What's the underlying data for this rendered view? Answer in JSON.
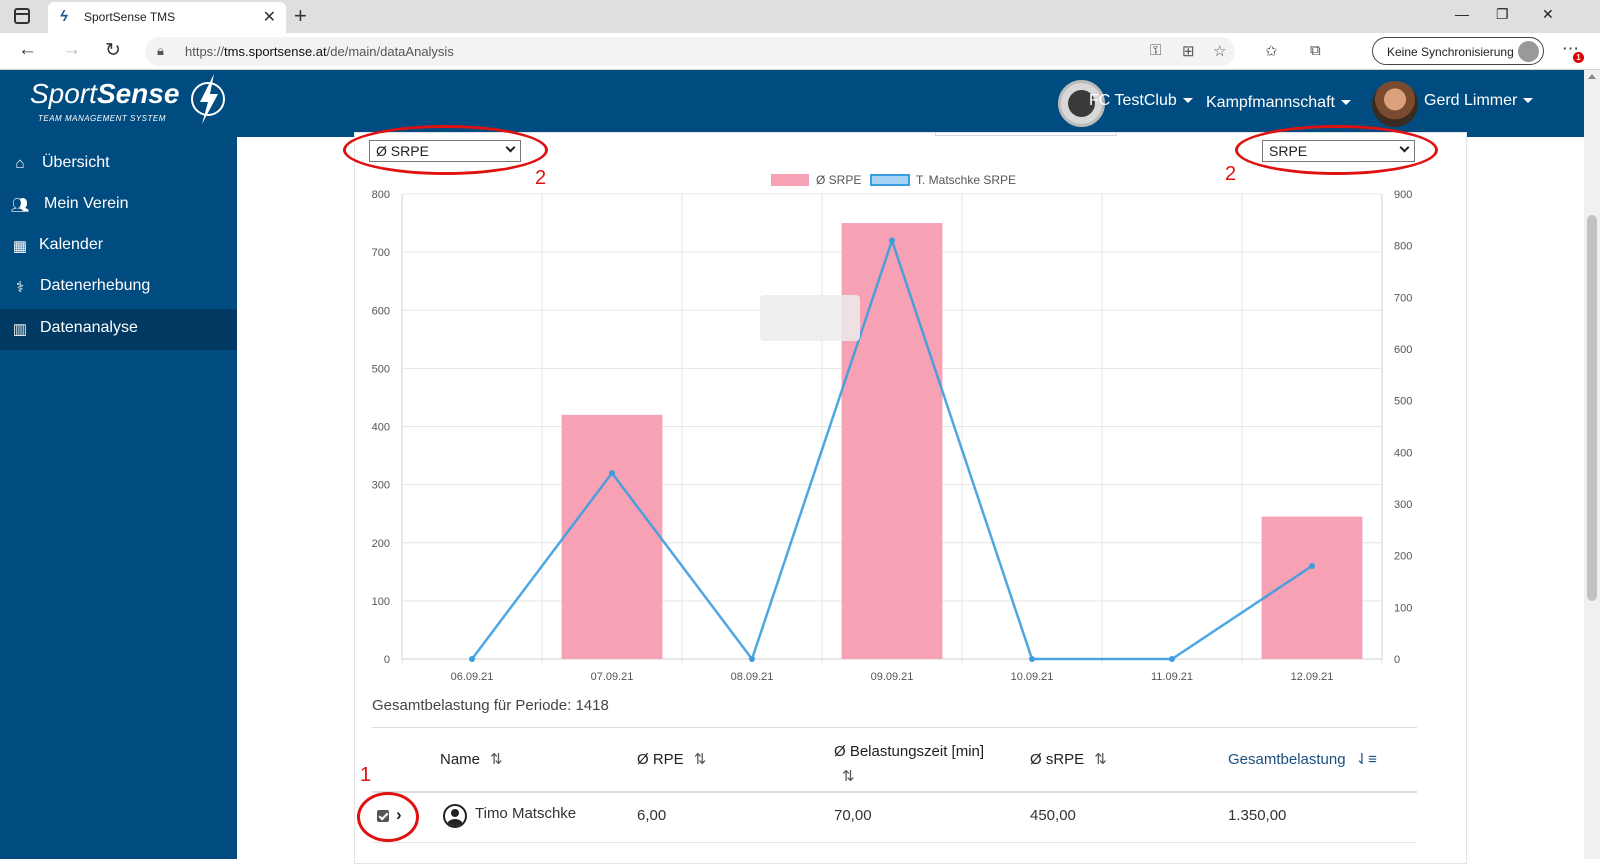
{
  "browser": {
    "tab_title": "SportSense TMS",
    "url_prefix": "https://",
    "url_host": "tms.sportsense.at",
    "url_path": "/de/main/dataAnalysis",
    "sync_label": "Keine Synchronisierung",
    "notification_count": "1"
  },
  "header": {
    "logo_sport": "Sport",
    "logo_sense": "Sense",
    "logo_sub": "TEAM MANAGEMENT SYSTEM",
    "club": "FC TestClub",
    "team": "Kampfmannschaft",
    "user": "Gerd Limmer"
  },
  "sidebar": {
    "items": [
      {
        "label": "Übersicht",
        "icon": "home-icon"
      },
      {
        "label": "Mein Verein",
        "icon": "users-icon"
      },
      {
        "label": "Kalender",
        "icon": "calendar-icon"
      },
      {
        "label": "Datenerhebung",
        "icon": "stethoscope-icon"
      },
      {
        "label": "Datenanalyse",
        "icon": "bar-chart-icon",
        "active": true
      }
    ]
  },
  "controls": {
    "left_select": "Ø SRPE",
    "right_select": "SRPE",
    "annotation_left": "2",
    "annotation_right": "2",
    "annotation_row": "1"
  },
  "chart_data": {
    "type": "bar",
    "categories": [
      "06.09.21",
      "07.09.21",
      "08.09.21",
      "09.09.21",
      "10.09.21",
      "11.09.21",
      "12.09.21"
    ],
    "series": [
      {
        "name": "Ø SRPE",
        "type": "bar",
        "axis": "left",
        "values": [
          0,
          420,
          0,
          750,
          0,
          0,
          245
        ],
        "color": "#f7a1b5"
      },
      {
        "name": "T. Matschke SRPE",
        "type": "line",
        "axis": "right",
        "values": [
          0,
          360,
          0,
          810,
          0,
          0,
          180
        ],
        "color": "#3a9de0"
      }
    ],
    "y_left": {
      "min": 0,
      "max": 800,
      "ticks": [
        0,
        100,
        200,
        300,
        400,
        500,
        600,
        700,
        800
      ]
    },
    "y_right": {
      "min": 0,
      "max": 900,
      "ticks": [
        0,
        100,
        200,
        300,
        400,
        500,
        600,
        700,
        800,
        900
      ]
    },
    "legend": "top-center",
    "grid": true
  },
  "summary": "Gesamtbelastung für Periode: 1418",
  "table": {
    "headers": [
      "Name",
      "Ø RPE",
      "Ø Belastungszeit [min]",
      "Ø sRPE",
      "Gesamtbelastung"
    ],
    "rows": [
      {
        "name": "Timo Matschke",
        "rpe": "6,00",
        "zeit": "70,00",
        "srpe": "450,00",
        "gesamt": "1.350,00"
      }
    ]
  }
}
